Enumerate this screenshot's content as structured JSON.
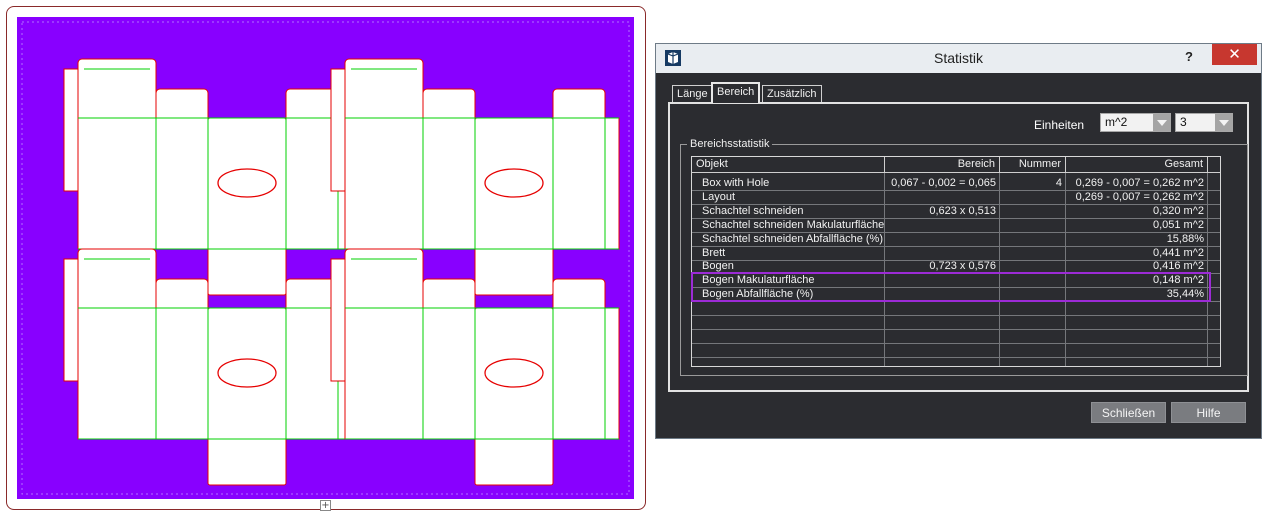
{
  "canvas": {
    "background_color": "#8800ff",
    "cut_line_color": "#e60000",
    "crease_line_color": "#00d000",
    "add_handle_glyph": "+"
  },
  "dialog": {
    "title": "Statistik",
    "help_label": "?",
    "close_label": "✕",
    "tabs": [
      {
        "label": "Länge",
        "active": false
      },
      {
        "label": "Bereich",
        "active": true
      },
      {
        "label": "Zusätzlich",
        "active": false
      }
    ],
    "units": {
      "label": "Einheiten",
      "unit_value": "m^2",
      "precision_value": "3"
    },
    "group_title": "Bereichsstatistik",
    "table": {
      "headers": [
        "Objekt",
        "Bereich",
        "Nummer",
        "Gesamt"
      ],
      "rows": [
        {
          "objekt": "Box with Hole",
          "bereich": "0,067 - 0,002 = 0,065",
          "nummer": "4",
          "gesamt": "0,269 - 0,007 = 0,262 m^2"
        },
        {
          "objekt": "Layout",
          "bereich": "",
          "nummer": "",
          "gesamt": "0,269 - 0,007 = 0,262 m^2"
        },
        {
          "objekt": "Schachtel schneiden",
          "bereich": "0,623 x 0,513",
          "nummer": "",
          "gesamt": "0,320 m^2"
        },
        {
          "objekt": "Schachtel schneiden Makulaturfläche",
          "bereich": "",
          "nummer": "",
          "gesamt": "0,051 m^2"
        },
        {
          "objekt": "Schachtel schneiden Abfallfläche (%)",
          "bereich": "",
          "nummer": "",
          "gesamt": "15,88%"
        },
        {
          "objekt": "Brett",
          "bereich": "",
          "nummer": "",
          "gesamt": "0,441 m^2"
        },
        {
          "objekt": "Bogen",
          "bereich": "0,723 x 0,576",
          "nummer": "",
          "gesamt": "0,416 m^2"
        },
        {
          "objekt": "Bogen Makulaturfläche",
          "bereich": "",
          "nummer": "",
          "gesamt": "0,148 m^2"
        },
        {
          "objekt": "Bogen Abfallfläche (%)",
          "bereich": "",
          "nummer": "",
          "gesamt": "35,44%"
        }
      ],
      "highlight_color": "#9c2bd6"
    },
    "buttons": {
      "close": "Schließen",
      "help": "Hilfe"
    }
  }
}
